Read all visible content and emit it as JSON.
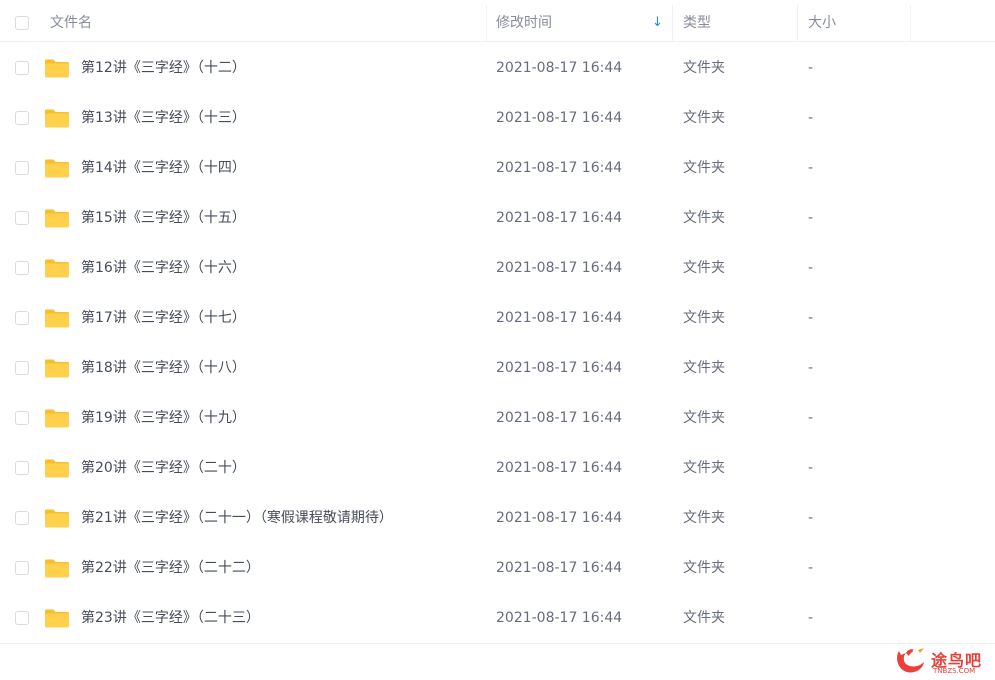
{
  "header": {
    "col_name": "文件名",
    "col_time": "修改时间",
    "sort_indicator": "↓",
    "col_type": "类型",
    "col_size": "大小"
  },
  "files": [
    {
      "name": "第12讲《三字经》（十二）",
      "time": "2021-08-17 16:44",
      "type": "文件夹",
      "size": "-"
    },
    {
      "name": "第13讲《三字经》（十三）",
      "time": "2021-08-17 16:44",
      "type": "文件夹",
      "size": "-"
    },
    {
      "name": "第14讲《三字经》（十四）",
      "time": "2021-08-17 16:44",
      "type": "文件夹",
      "size": "-"
    },
    {
      "name": "第15讲《三字经》（十五）",
      "time": "2021-08-17 16:44",
      "type": "文件夹",
      "size": "-"
    },
    {
      "name": "第16讲《三字经》（十六）",
      "time": "2021-08-17 16:44",
      "type": "文件夹",
      "size": "-"
    },
    {
      "name": "第17讲《三字经》（十七）",
      "time": "2021-08-17 16:44",
      "type": "文件夹",
      "size": "-"
    },
    {
      "name": "第18讲《三字经》（十八）",
      "time": "2021-08-17 16:44",
      "type": "文件夹",
      "size": "-"
    },
    {
      "name": "第19讲《三字经》（十九）",
      "time": "2021-08-17 16:44",
      "type": "文件夹",
      "size": "-"
    },
    {
      "name": "第20讲《三字经》（二十）",
      "time": "2021-08-17 16:44",
      "type": "文件夹",
      "size": "-"
    },
    {
      "name": "第21讲《三字经》（二十一）（寒假课程敬请期待）",
      "time": "2021-08-17 16:44",
      "type": "文件夹",
      "size": "-"
    },
    {
      "name": "第22讲《三字经》（二十二）",
      "time": "2021-08-17 16:44",
      "type": "文件夹",
      "size": "-"
    },
    {
      "name": "第23讲《三字经》（二十三）",
      "time": "2021-08-17 16:44",
      "type": "文件夹",
      "size": "-"
    }
  ],
  "watermark": {
    "text": "途鸟吧",
    "subtext": "TNBZS.COM"
  },
  "colors": {
    "folder": "#ffd04b",
    "folder_tab": "#f7bf2c",
    "sort_accent": "#1e88f4",
    "watermark": "#e8413c"
  },
  "icons": {
    "folder": "folder-icon",
    "sort": "sort-down-arrow-icon",
    "logo": "bird-logo-icon"
  }
}
